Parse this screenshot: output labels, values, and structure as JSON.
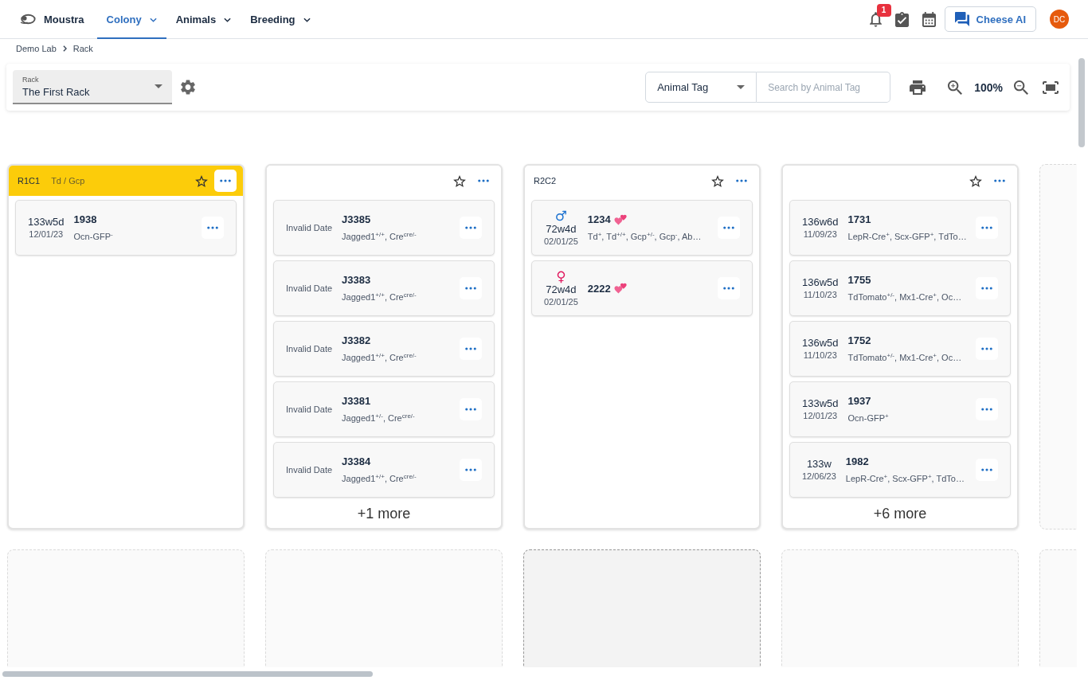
{
  "app": {
    "name": "Moustra"
  },
  "nav": [
    {
      "label": "Colony",
      "selected": true
    },
    {
      "label": "Animals",
      "selected": false
    },
    {
      "label": "Breeding",
      "selected": false
    }
  ],
  "notifications": {
    "badge": "1"
  },
  "assistant_button": {
    "label": "Cheese AI"
  },
  "avatar": {
    "initials": "DC"
  },
  "breadcrumb": [
    "Demo Lab",
    "Rack"
  ],
  "toolbar": {
    "rack_select": {
      "label": "Rack",
      "value": "The First Rack"
    },
    "search_type": {
      "value": "Animal Tag"
    },
    "search": {
      "placeholder": "Search by Animal Tag"
    },
    "zoom": "100%"
  },
  "rack": {
    "rows": [
      {
        "slots": [
          {
            "kind": "cage",
            "label": "R1C1",
            "strain": "Td / Gcp",
            "highlighted": true,
            "starred": false,
            "animals": [
              {
                "age": "133w5d",
                "date": "12/01/23",
                "tag": "1938",
                "in_mating": false,
                "genotype": "Ocn-GFP$^{-}$"
              }
            ]
          },
          {
            "kind": "cage",
            "highlighted": false,
            "starred": false,
            "animals": [
              {
                "date": "Invalid Date",
                "tag": "J3385",
                "in_mating": false,
                "genotype": "Jagged1$^{+/+}$, Cre$^{cre/-}$"
              },
              {
                "date": "Invalid Date",
                "tag": "J3383",
                "in_mating": false,
                "genotype": "Jagged1$^{+/+}$, Cre$^{cre/-}$"
              },
              {
                "date": "Invalid Date",
                "tag": "J3382",
                "in_mating": false,
                "genotype": "Jagged1$^{+/+}$, Cre$^{cre/-}$"
              },
              {
                "date": "Invalid Date",
                "tag": "J3381",
                "in_mating": false,
                "genotype": "Jagged1$^{+/-}$, Cre$^{cre/-}$"
              },
              {
                "date": "Invalid Date",
                "tag": "J3384",
                "in_mating": false,
                "genotype": "Jagged1$^{+/+}$, Cre$^{cre/-}$"
              }
            ],
            "more": "+1 more"
          },
          {
            "kind": "cage",
            "label": "R2C2",
            "highlighted": false,
            "starred": false,
            "animals": [
              {
                "sex": {
                  "symbol": "♂",
                  "color": "#1e73d0"
                },
                "age": "72w4d",
                "date": "02/01/25",
                "tag": "1234",
                "in_mating": true,
                "genotype": "Td$^{+}$, Td$^{+/+}$, Gcp$^{+/-}$, Gcp$^{-}$, Ab…"
              },
              {
                "sex": {
                  "symbol": "♀",
                  "color": "#e0195f"
                },
                "age": "72w4d",
                "date": "02/01/25",
                "tag": "2222",
                "in_mating": true
              }
            ]
          },
          {
            "kind": "cage",
            "highlighted": false,
            "starred": false,
            "animals": [
              {
                "age": "136w6d",
                "date": "11/09/23",
                "tag": "1731",
                "in_mating": false,
                "genotype": "LepR-Cre$^{+}$, Scx-GFP$^{+}$, TdTo…"
              },
              {
                "age": "136w5d",
                "date": "11/10/23",
                "tag": "1755",
                "in_mating": false,
                "genotype": "TdTomato$^{+/-}$, Mx1-Cre$^{+}$, Oc…"
              },
              {
                "age": "136w5d",
                "date": "11/10/23",
                "tag": "1752",
                "in_mating": false,
                "genotype": "TdTomato$^{+/-}$, Mx1-Cre$^{+}$, Oc…"
              },
              {
                "age": "133w5d",
                "date": "12/01/23",
                "tag": "1937",
                "in_mating": false,
                "genotype": "Ocn-GFP$^{+}$"
              },
              {
                "age": "133w",
                "date": "12/06/23",
                "tag": "1982",
                "in_mating": false,
                "genotype": "LepR-Cre$^{+}$, Scx-GFP$^{+}$, TdTo…"
              }
            ],
            "more": "+6 more"
          },
          {
            "kind": "empty",
            "highlighted": false
          }
        ]
      },
      {
        "slots": [
          {
            "kind": "empty",
            "highlighted": false
          },
          {
            "kind": "empty",
            "highlighted": false
          },
          {
            "kind": "empty",
            "highlighted": true
          },
          {
            "kind": "empty",
            "highlighted": false
          },
          {
            "kind": "empty",
            "highlighted": false
          }
        ]
      }
    ]
  }
}
